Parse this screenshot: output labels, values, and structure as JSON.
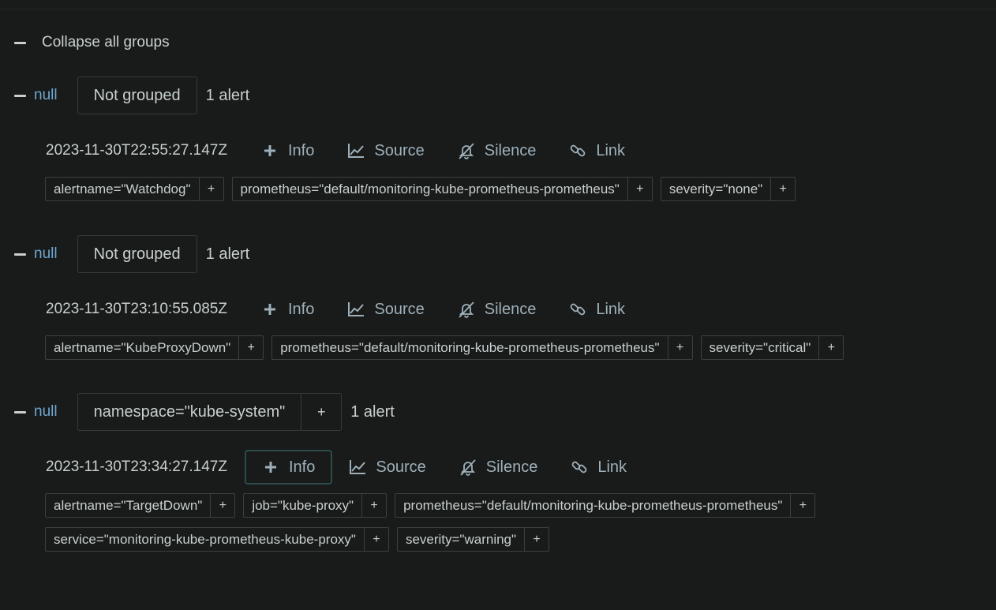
{
  "collapse_all_label": "Collapse all groups",
  "groups": [
    {
      "toggle_label": "null",
      "group_label": "Not grouped",
      "group_has_plus": false,
      "alert_count": "1 alert",
      "alert": {
        "timestamp": "2023-11-30T22:55:27.147Z",
        "actions": {
          "info": "Info",
          "source": "Source",
          "silence": "Silence",
          "link": "Link"
        },
        "labels": [
          "alertname=\"Watchdog\"",
          "prometheus=\"default/monitoring-kube-prometheus-prometheus\"",
          "severity=\"none\""
        ]
      }
    },
    {
      "toggle_label": "null",
      "group_label": "Not grouped",
      "group_has_plus": false,
      "alert_count": "1 alert",
      "alert": {
        "timestamp": "2023-11-30T23:10:55.085Z",
        "actions": {
          "info": "Info",
          "source": "Source",
          "silence": "Silence",
          "link": "Link"
        },
        "labels": [
          "alertname=\"KubeProxyDown\"",
          "prometheus=\"default/monitoring-kube-prometheus-prometheus\"",
          "severity=\"critical\""
        ]
      }
    },
    {
      "toggle_label": "null",
      "group_label": "namespace=\"kube-system\"",
      "group_has_plus": true,
      "group_plus": "+",
      "alert_count": "1 alert",
      "alert": {
        "timestamp": "2023-11-30T23:34:27.147Z",
        "actions": {
          "info": "Info",
          "source": "Source",
          "silence": "Silence",
          "link": "Link"
        },
        "labels": [
          "alertname=\"TargetDown\"",
          "job=\"kube-proxy\"",
          "prometheus=\"default/monitoring-kube-prometheus-prometheus\"",
          "service=\"monitoring-kube-prometheus-kube-proxy\"",
          "severity=\"warning\""
        ]
      }
    }
  ],
  "chip_plus": "+",
  "icons": {
    "collapse": "minus-icon",
    "info": "plus-icon",
    "source": "chart-line-icon",
    "silence": "bell-slash-icon",
    "link": "link-icon"
  }
}
